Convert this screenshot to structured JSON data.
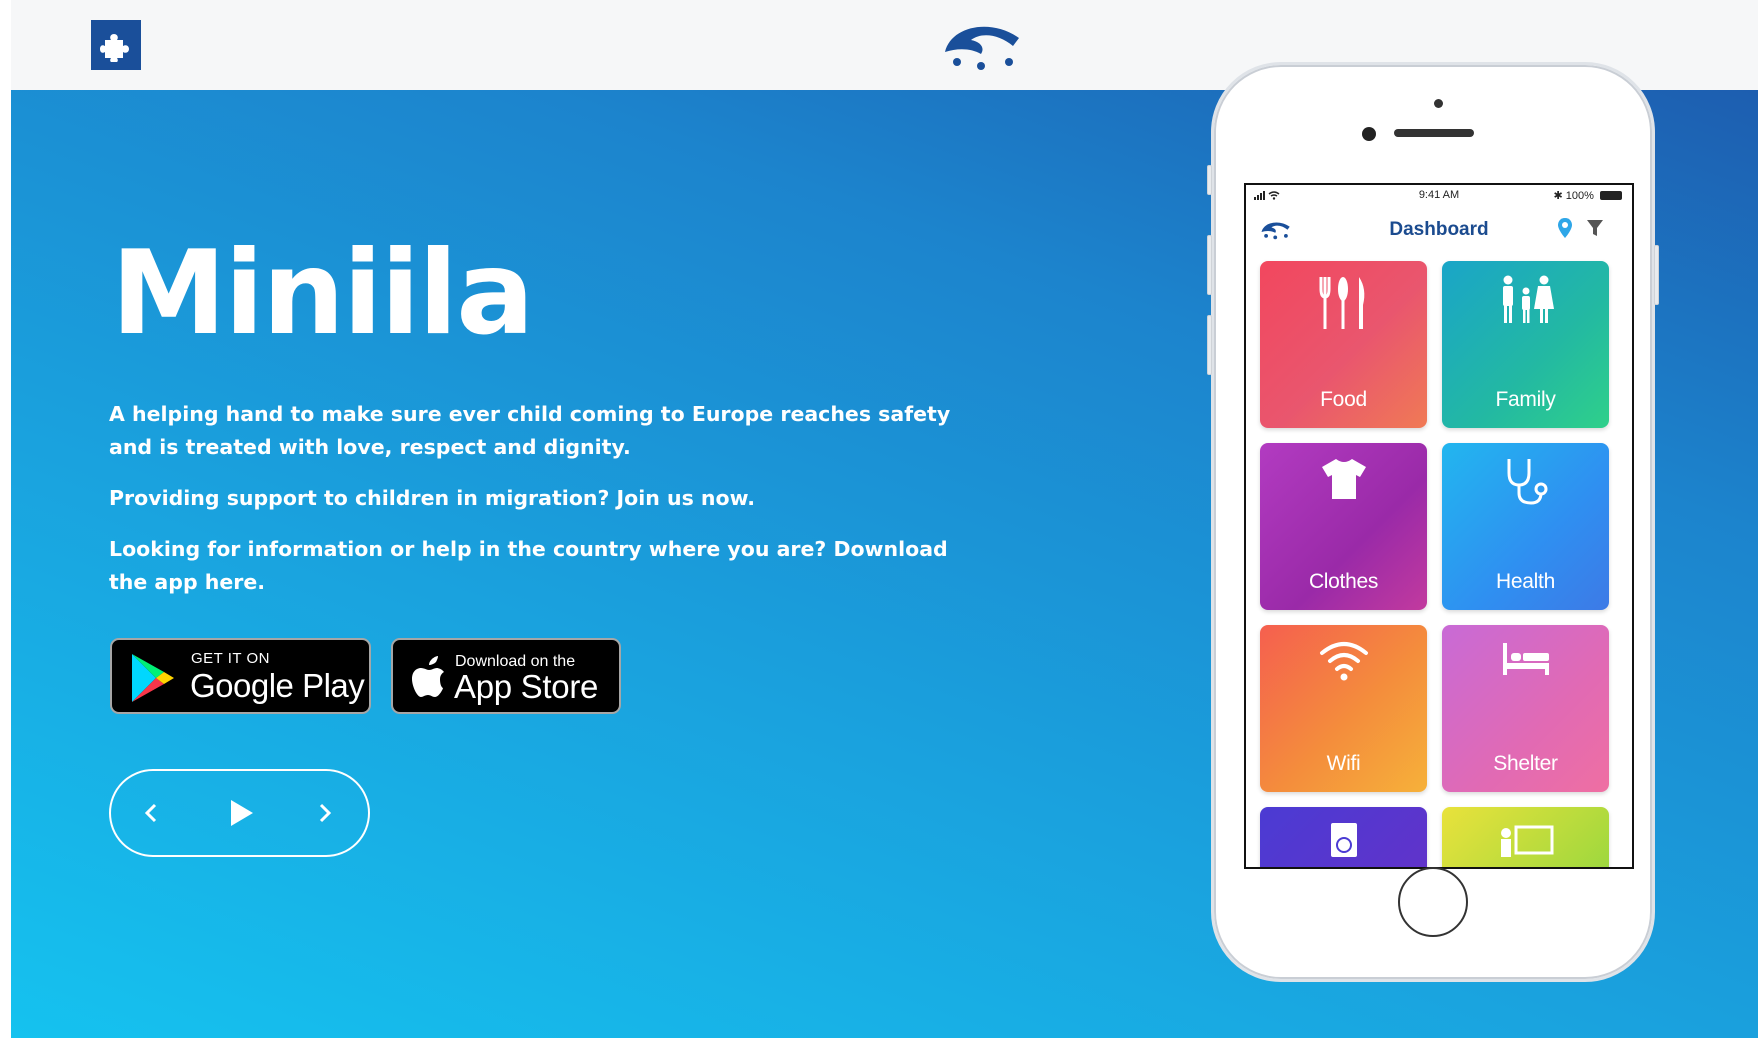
{
  "header": {
    "puzzle_icon": "puzzle-icon",
    "logo_icon": "miniila-logo-icon"
  },
  "hero": {
    "title": "Miniila",
    "paragraphs": [
      "A helping hand to make sure ever child coming to Europe reaches safety and is treated with love, respect and dignity.",
      "Providing support to children in migration? Join us now.",
      "Looking for information or help in the country where you are? Download the app here."
    ],
    "google_play": {
      "small": "GET IT ON",
      "big": "Google Play"
    },
    "app_store": {
      "small": "Download on the",
      "big": "App Store"
    },
    "slider_controls": {
      "prev": "chevron-left-icon",
      "play": "play-icon",
      "next": "chevron-right-icon"
    }
  },
  "phone": {
    "status": {
      "time": "9:41 AM",
      "battery": "100%"
    },
    "dashboard_title": "Dashboard",
    "tiles": [
      {
        "label": "Food",
        "icon": "cutlery-icon"
      },
      {
        "label": "Family",
        "icon": "family-icon"
      },
      {
        "label": "Clothes",
        "icon": "tshirt-icon"
      },
      {
        "label": "Health",
        "icon": "stethoscope-icon"
      },
      {
        "label": "Wifi",
        "icon": "wifi-icon"
      },
      {
        "label": "Shelter",
        "icon": "bed-icon"
      },
      {
        "label": "",
        "icon": "passport-icon"
      },
      {
        "label": "",
        "icon": "classroom-icon"
      }
    ]
  },
  "colors": {
    "brand_blue": "#1a4f9a",
    "hero_top": "#1c84cd",
    "hero_bottom": "#15c2ef"
  }
}
